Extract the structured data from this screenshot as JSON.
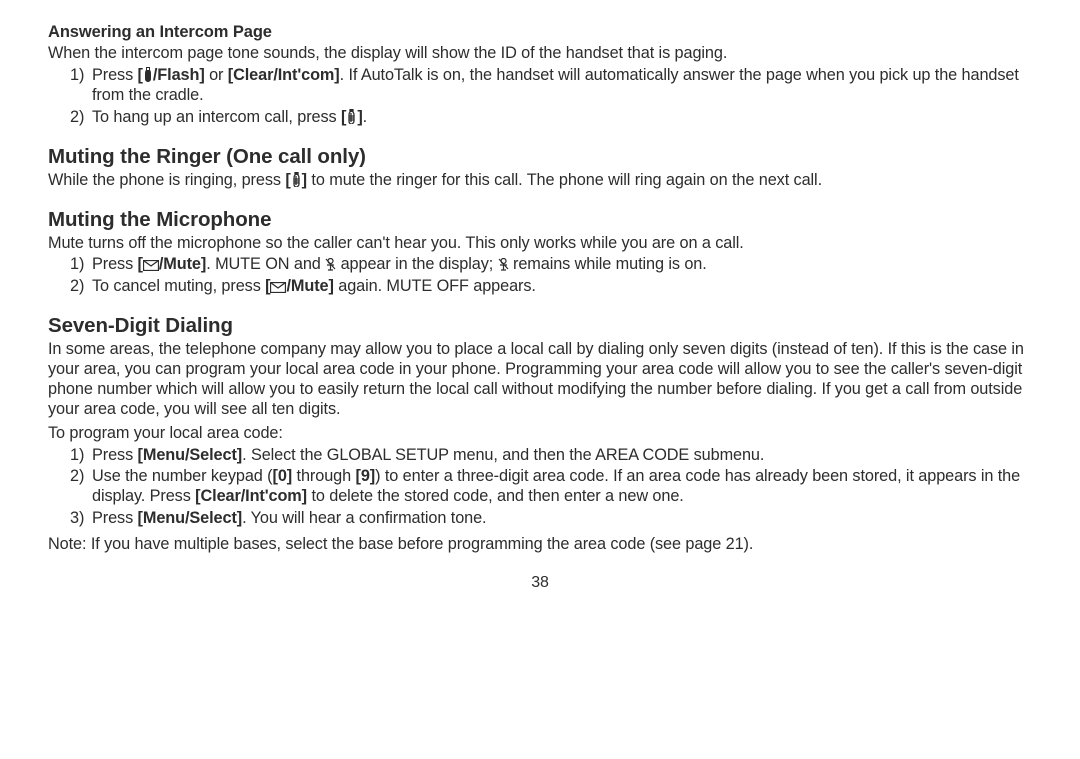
{
  "section1": {
    "heading": "Answering an Intercom Page",
    "intro": "When the intercom page tone sounds, the display will show the ID of the handset that is paging.",
    "item1_a": "Press ",
    "item1_bold1": "[",
    "item1_bold2": "/Flash]",
    "item1_or": " or ",
    "item1_bold3": "[Clear/Int'com]",
    "item1_b": ". If AutoTalk is on, the handset will automatically answer the page when you pick up the handset from the cradle.",
    "item2_a": "To hang up an intercom call, press ",
    "item2_bold": "[",
    "item2_bold2": "]",
    "item2_b": "."
  },
  "section2": {
    "heading": "Muting the Ringer (One call only)",
    "text_a": "While the phone is ringing, press ",
    "text_bold1": "[",
    "text_bold2": "]",
    "text_b": " to mute the ringer for this call. The phone will ring again on the next call."
  },
  "section3": {
    "heading": "Muting the Microphone",
    "intro": "Mute turns off the microphone so the caller can't hear you. This only works while you are on a call.",
    "item1_a": "Press ",
    "item1_bold1": "[",
    "item1_bold2": "/Mute]",
    "item1_b": ". MUTE ON and ",
    "item1_c": " appear in the display; ",
    "item1_d": " remains while muting is on.",
    "item2_a": "To cancel muting, press ",
    "item2_bold1": "[",
    "item2_bold2": "/Mute]",
    "item2_b": " again. MUTE OFF appears."
  },
  "section4": {
    "heading": "Seven-Digit Dialing",
    "intro": "In some areas, the telephone company may allow you to place a local call by dialing only seven digits (instead of ten). If this is the case in your area, you can program your local area code in your phone. Programming your area code will allow you to see the caller's seven-digit phone number which will allow you to easily return the local call without modifying the number before dialing. If you get a call from outside your area code, you will see all ten digits.",
    "lead": "To program your local area code:",
    "item1_a": "Press ",
    "item1_bold": "[Menu/Select]",
    "item1_b": ". Select the GLOBAL SETUP menu, and then the AREA CODE submenu.",
    "item2_a": "Use the number keypad (",
    "item2_bold0": "[0]",
    "item2_mid": " through ",
    "item2_bold9": "[9]",
    "item2_b": ") to enter a three-digit area code. If an area code has already been stored, it appears in the display. Press ",
    "item2_boldc": "[Clear/Int'com]",
    "item2_c": "  to delete the stored code, and then enter a new one.",
    "item3_a": "Press ",
    "item3_bold": "[Menu/Select]",
    "item3_b": ". You will hear a confirmation tone.",
    "note": "Note:   If you have multiple bases, select the base before programming the area code (see page 21)."
  },
  "pagenum": "38"
}
